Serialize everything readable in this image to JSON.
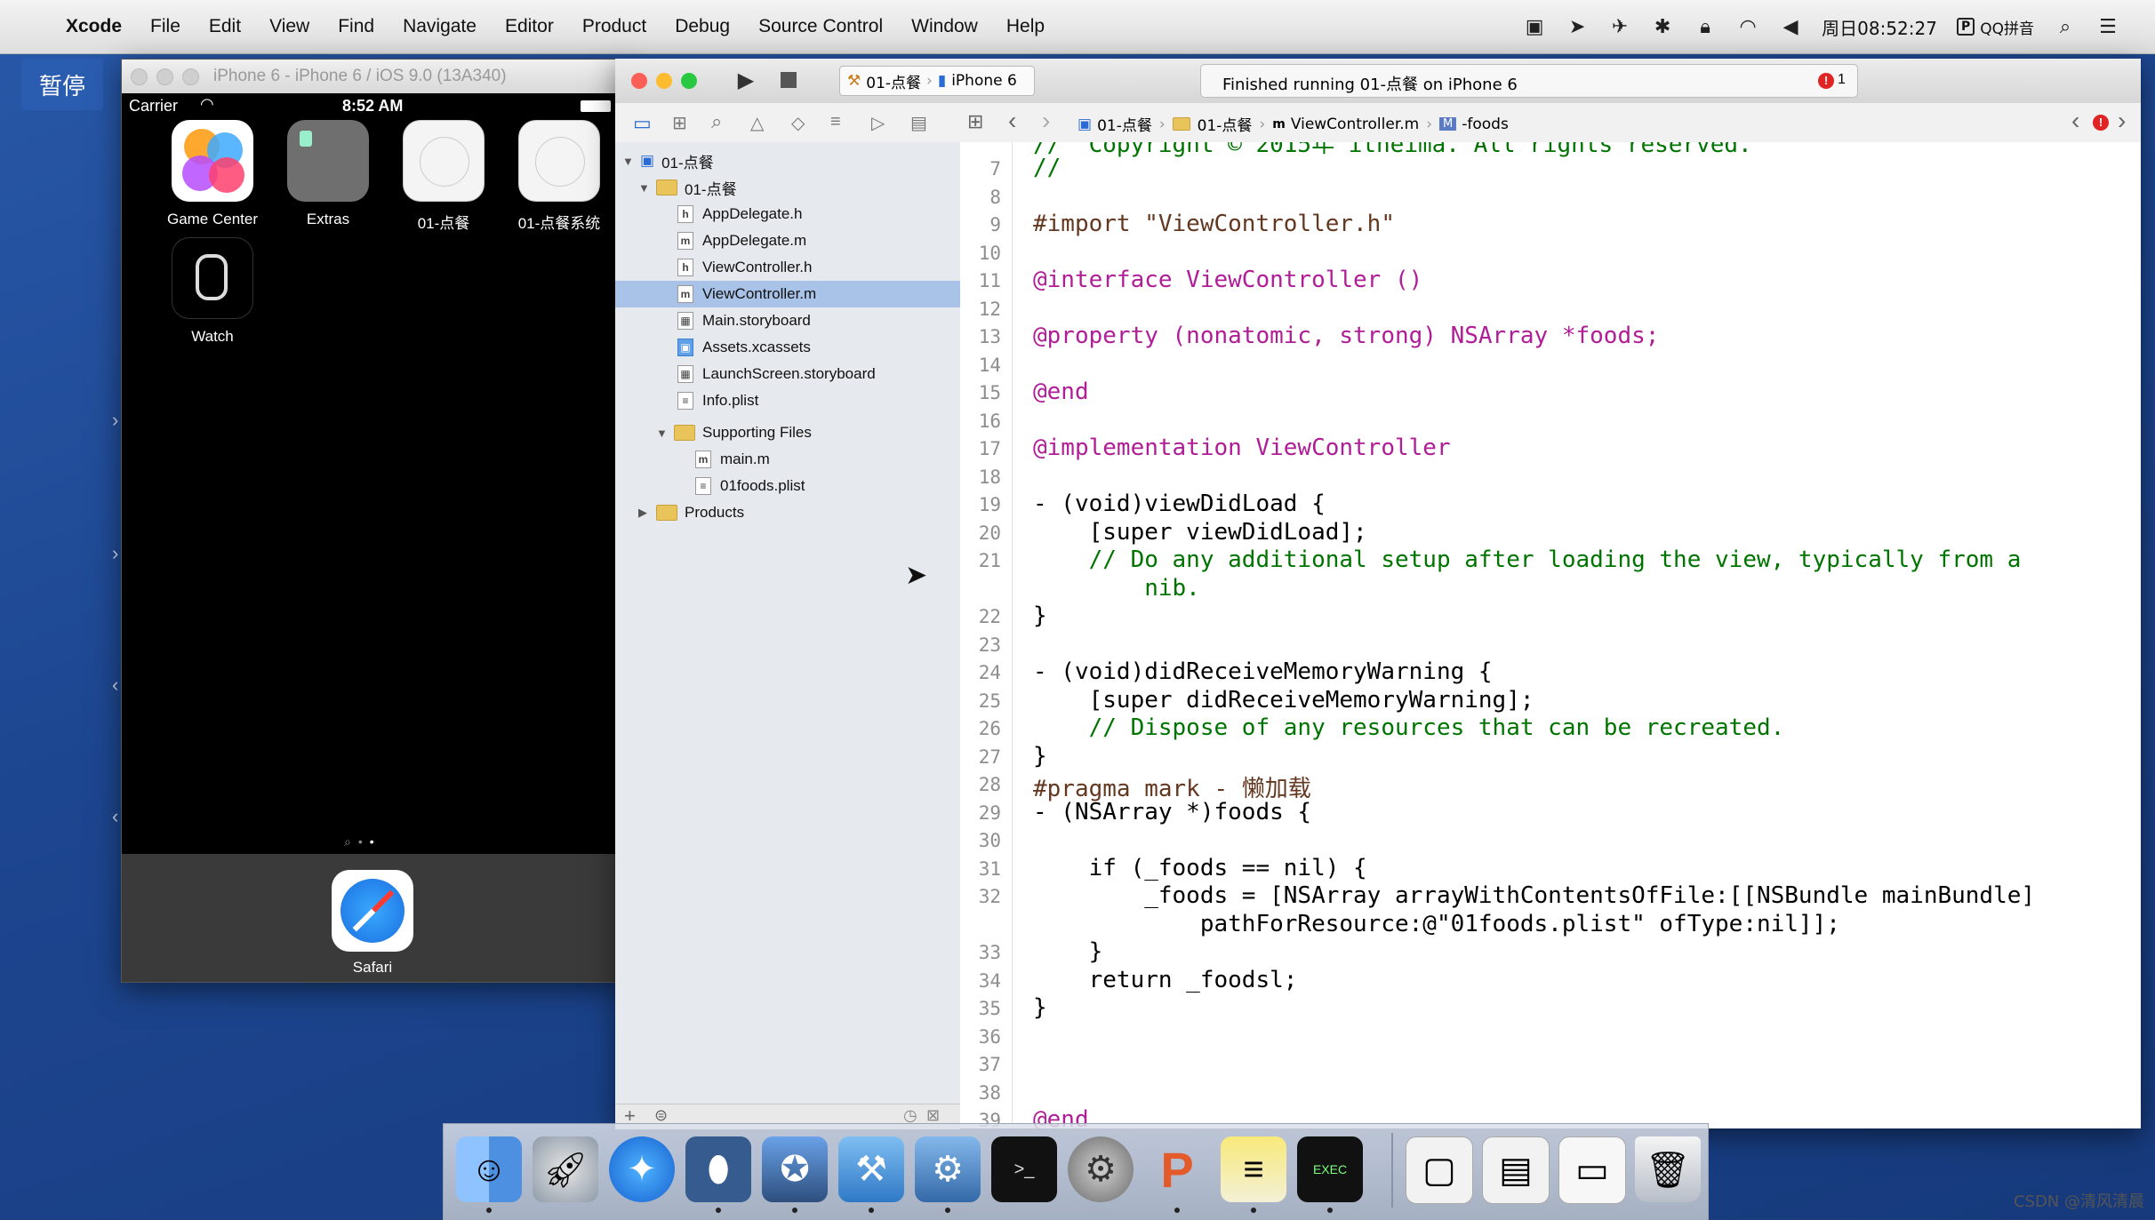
{
  "menubar": {
    "app": "Xcode",
    "items": [
      "File",
      "Edit",
      "View",
      "Find",
      "Navigate",
      "Editor",
      "Product",
      "Debug",
      "Source Control",
      "Window",
      "Help"
    ],
    "clock": "周日08:52:27",
    "input_method": "QQ拼音"
  },
  "pause_badge": "暂停",
  "simulator": {
    "title": "iPhone 6 - iPhone 6 / iOS 9.0 (13A340)",
    "carrier": "Carrier",
    "time": "8:52 AM",
    "apps": [
      {
        "label": "Game Center",
        "icon": "game-center-icon"
      },
      {
        "label": "Extras",
        "icon": "extras-folder-icon"
      },
      {
        "label": "01-点餐",
        "icon": "app-placeholder-icon"
      },
      {
        "label": "01-点餐系统",
        "icon": "app-placeholder-icon"
      },
      {
        "label": "Watch",
        "icon": "watch-icon"
      }
    ],
    "dock_app": "Safari"
  },
  "xcode": {
    "scheme": "01-点餐",
    "device": "iPhone 6",
    "activity": "Finished running 01-点餐 on iPhone 6",
    "error_count": "1",
    "jumpbar": [
      "01-点餐",
      "01-点餐",
      "ViewController.m",
      "-foods"
    ],
    "navigator": {
      "project": "01-点餐",
      "group": "01-点餐",
      "files": [
        {
          "name": "AppDelegate.h",
          "type": "h"
        },
        {
          "name": "AppDelegate.m",
          "type": "m"
        },
        {
          "name": "ViewController.h",
          "type": "h"
        },
        {
          "name": "ViewController.m",
          "type": "m",
          "selected": true
        },
        {
          "name": "Main.storyboard",
          "type": "storyboard"
        },
        {
          "name": "Assets.xcassets",
          "type": "assets"
        },
        {
          "name": "LaunchScreen.storyboard",
          "type": "storyboard"
        },
        {
          "name": "Info.plist",
          "type": "plist"
        }
      ],
      "supporting": "Supporting Files",
      "supporting_files": [
        {
          "name": "main.m",
          "type": "m"
        },
        {
          "name": "01foods.plist",
          "type": "plist"
        }
      ],
      "products": "Products"
    },
    "code": {
      "line_numbers": [
        "7",
        "8",
        "9",
        "10",
        "11",
        "12",
        "13",
        "14",
        "15",
        "16",
        "17",
        "18",
        "19",
        "20",
        "21",
        "",
        "22",
        "23",
        "24",
        "25",
        "26",
        "27",
        "28",
        "29",
        "30",
        "31",
        "32",
        "",
        "33",
        "34",
        "35",
        "36",
        "37",
        "38",
        "39"
      ],
      "top_partial": "//  Copyright © 2015年 itheima. All rights reserved.",
      "lines": [
        "//",
        "",
        "#import \"ViewController.h\"",
        "",
        "@interface ViewController ()",
        "",
        "@property (nonatomic, strong) NSArray *foods;",
        "",
        "@end",
        "",
        "@implementation ViewController",
        "",
        "- (void)viewDidLoad {",
        "    [super viewDidLoad];",
        "    // Do any additional setup after loading the view, typically from a",
        "        nib.",
        "}",
        "",
        "- (void)didReceiveMemoryWarning {",
        "    [super didReceiveMemoryWarning];",
        "    // Dispose of any resources that can be recreated.",
        "}",
        "#pragma mark - 懒加载",
        "- (NSArray *)foods {",
        "",
        "    if (_foods == nil) {",
        "        _foods = [NSArray arrayWithContentsOfFile:[[NSBundle mainBundle]",
        "            pathForResource:@\"01foods.plist\" ofType:nil]];",
        "    }",
        "    return _foodsl;",
        "}",
        "",
        "",
        "",
        "@end"
      ]
    }
  },
  "dock": [
    "finder-icon",
    "launchpad-icon",
    "safari-icon",
    "mouse-icon",
    "imovie-icon",
    "xcode-icon",
    "instruments-icon",
    "terminal-icon",
    "system-preferences-icon",
    "powerpoint-icon",
    "notes-icon",
    "console-icon",
    "preview-icon",
    "screenshot-icon",
    "window-icon",
    "trash-icon"
  ],
  "watermark": "CSDN @清风清晨"
}
